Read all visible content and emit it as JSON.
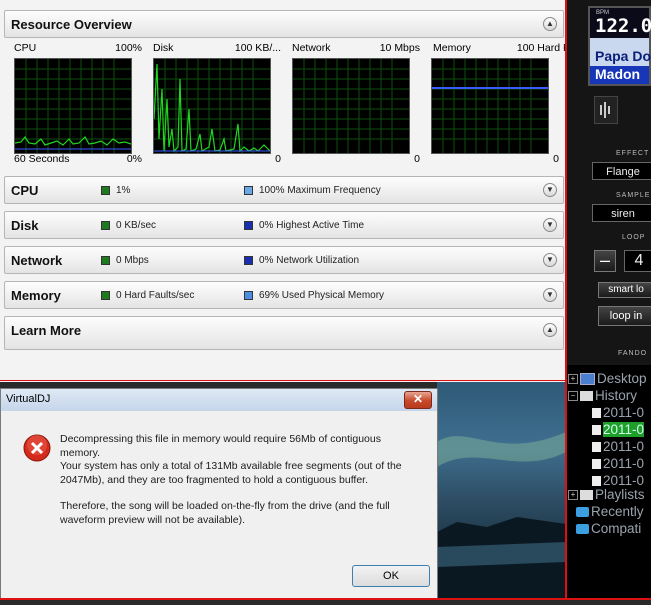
{
  "resmon": {
    "overview_title": "Resource Overview",
    "graphs": [
      {
        "title": "CPU",
        "max": "100%",
        "bottom_left": "60 Seconds",
        "bottom_right": "0%"
      },
      {
        "title": "Disk",
        "max": "100 KB/...",
        "bottom_left": "",
        "bottom_right": "0"
      },
      {
        "title": "Network",
        "max": "10 Mbps",
        "bottom_left": "",
        "bottom_right": "0"
      },
      {
        "title": "Memory",
        "max": "100 Hard F...",
        "bottom_left": "",
        "bottom_right": "0"
      }
    ],
    "sections": [
      {
        "title": "CPU",
        "stat1": "1%",
        "stat2": "100% Maximum Frequency",
        "color1": "#1e7a1e",
        "color2": "#6aa8e8"
      },
      {
        "title": "Disk",
        "stat1": "0 KB/sec",
        "stat2": "0% Highest Active Time",
        "color1": "#1e7a1e",
        "color2": "#1a2fb0"
      },
      {
        "title": "Network",
        "stat1": "0 Mbps",
        "stat2": "0% Network Utilization",
        "color1": "#1e7a1e",
        "color2": "#1a2fb0"
      },
      {
        "title": "Memory",
        "stat1": "0 Hard Faults/sec",
        "stat2": "69% Used Physical Memory",
        "color1": "#1e7a1e",
        "color2": "#4d8ee0"
      }
    ],
    "learn_more": "Learn More"
  },
  "vdj": {
    "bpm_label": "BPM",
    "bpm_value": "122.0",
    "song_line1": "Papa Do",
    "song_line2": "Madon",
    "effect_label": "EFFECT",
    "effect_value": "Flange",
    "sample_label": "SAMPLE",
    "sample_value": "siren",
    "loop_label": "LOOP",
    "loop_value": "4",
    "minus": "–",
    "smart_loop": "smart lo",
    "loop_in": "loop in",
    "brand": "FANDO"
  },
  "tree": {
    "desktop": "Desktop",
    "history": "History",
    "history_items": [
      "2011-0",
      "2011-0",
      "2011-0",
      "2011-0",
      "2011-0"
    ],
    "playlists": "Playlists",
    "recently": "Recently",
    "compat": "Compati"
  },
  "dialog": {
    "title": "VirtualDJ",
    "close": "✕",
    "msg1": "Decompressing this file in memory would require 56Mb of contiguous memory.",
    "msg2": "Your system has only a total of 131Mb available free segments (out of the 2047Mb), and they are too fragmented to hold a contiguous buffer.",
    "msg3": "Therefore, the song will be loaded on-the-fly from the drive (and the full waveform preview will not be available).",
    "ok": "OK"
  },
  "colors": {
    "graph_line": "#21d621",
    "memory_line": "#3a5cff",
    "selected_tree": "#1f9e2a"
  }
}
